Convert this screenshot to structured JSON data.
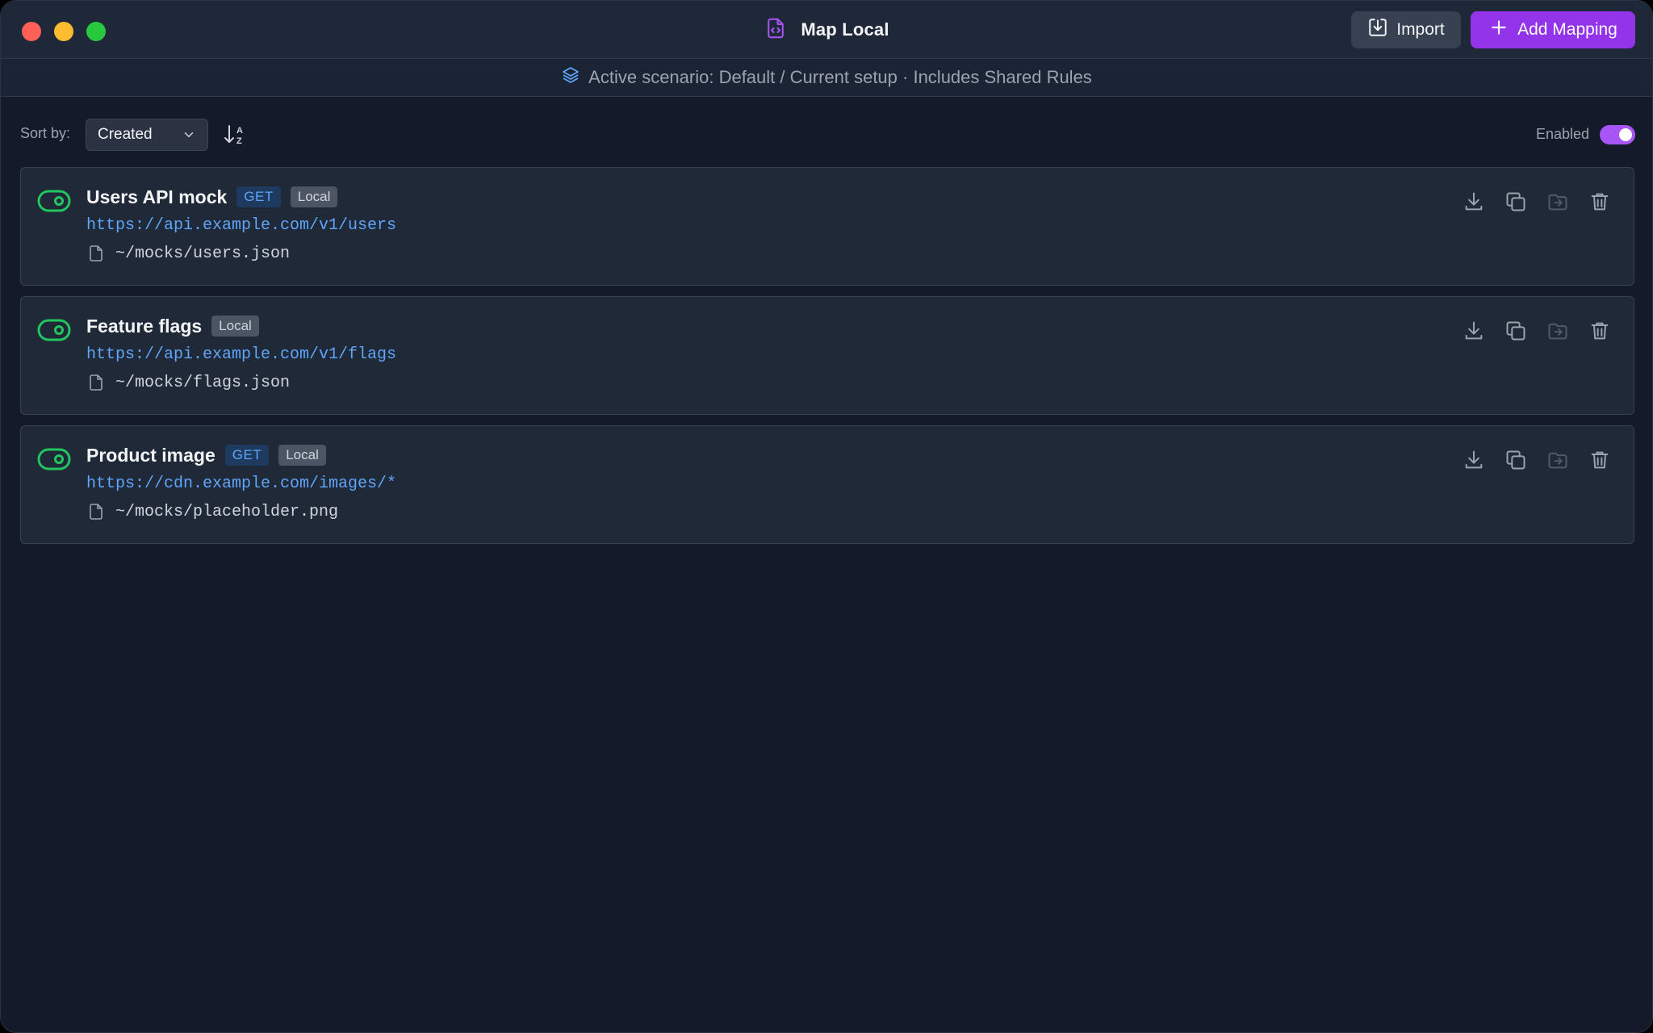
{
  "window": {
    "title": "Map Local",
    "title_icon": "file-code-icon"
  },
  "header": {
    "import_label": "Import",
    "add_label": "Add Mapping"
  },
  "scenario": {
    "text": "Active scenario: Default / Current setup · Includes Shared Rules",
    "icon": "layers-icon"
  },
  "toolbar": {
    "sort_label": "Sort by:",
    "sort_value": "Created",
    "enabled_label": "Enabled",
    "enabled": true
  },
  "mappings": [
    {
      "title": "Users API mock",
      "method": "GET",
      "scope": "Local",
      "url": "https://api.example.com/v1/users",
      "path": "~/mocks/users.json",
      "enabled": true
    },
    {
      "title": "Feature flags",
      "method": "",
      "scope": "Local",
      "url": "https://api.example.com/v1/flags",
      "path": "~/mocks/flags.json",
      "enabled": true
    },
    {
      "title": "Product image",
      "method": "GET",
      "scope": "Local",
      "url": "https://cdn.example.com/images/*",
      "path": "~/mocks/placeholder.png",
      "enabled": true
    }
  ],
  "colors": {
    "accent": "#9333ea",
    "toggle_on": "#22c55e",
    "link": "#60a5fa",
    "background": "#141a29"
  }
}
